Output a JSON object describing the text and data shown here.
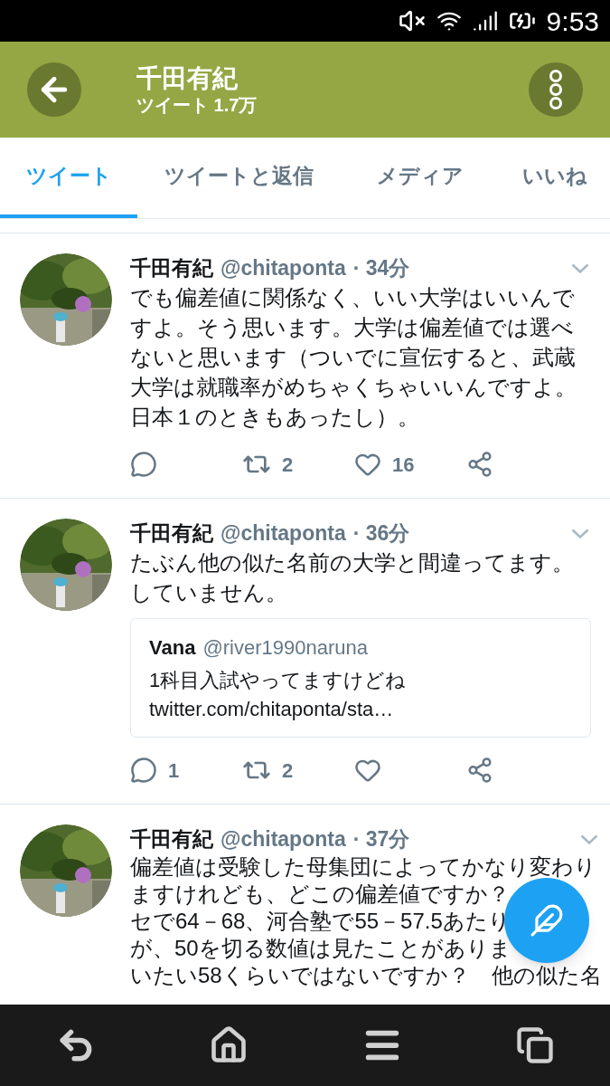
{
  "status_bar": {
    "time": "9:53"
  },
  "header": {
    "title": "千田有紀",
    "subtitle": "ツイート 1.7万"
  },
  "tabs": [
    {
      "label": "ツイート",
      "selected": true
    },
    {
      "label": "ツイートと返信",
      "selected": false
    },
    {
      "label": "メディア",
      "selected": false
    },
    {
      "label": "いいね",
      "selected": false
    }
  ],
  "tweets": [
    {
      "name": "千田有紀",
      "handle": "@chitaponta",
      "time": "· 34分",
      "body": "でも偏差値に関係なく、いい大学はいいんですよ。そう思います。大学は偏差値では選べないと思います（ついでに宣伝すると、武蔵大学は就職率がめちゃくちゃいいんですよ。日本１のときもあったし）。",
      "actions": {
        "retweets": "2",
        "likes": "16"
      }
    },
    {
      "name": "千田有紀",
      "handle": "@chitaponta",
      "time": "· 36分",
      "body": "たぶん他の似た名前の大学と間違ってます。していません。",
      "quote": {
        "name": "Vana",
        "handle": "@river1990naruna",
        "text": "1科目入試やってますけどね twitter.com/chitaponta/sta…"
      },
      "actions": {
        "replies": "1",
        "retweets": "2"
      }
    },
    {
      "name": "千田有紀",
      "handle": "@chitaponta",
      "time": "· 37分",
      "lines": [
        "偏差値は受験した母集団によってかなり変わり",
        "ますけれども、どこの偏差値ですか？",
        "セで64－68、河合塾で55－57.5あたり",
        "が、50を切る数値は見たことがありま",
        "いたい58くらいではないですか？　他の似た名"
      ]
    }
  ]
}
